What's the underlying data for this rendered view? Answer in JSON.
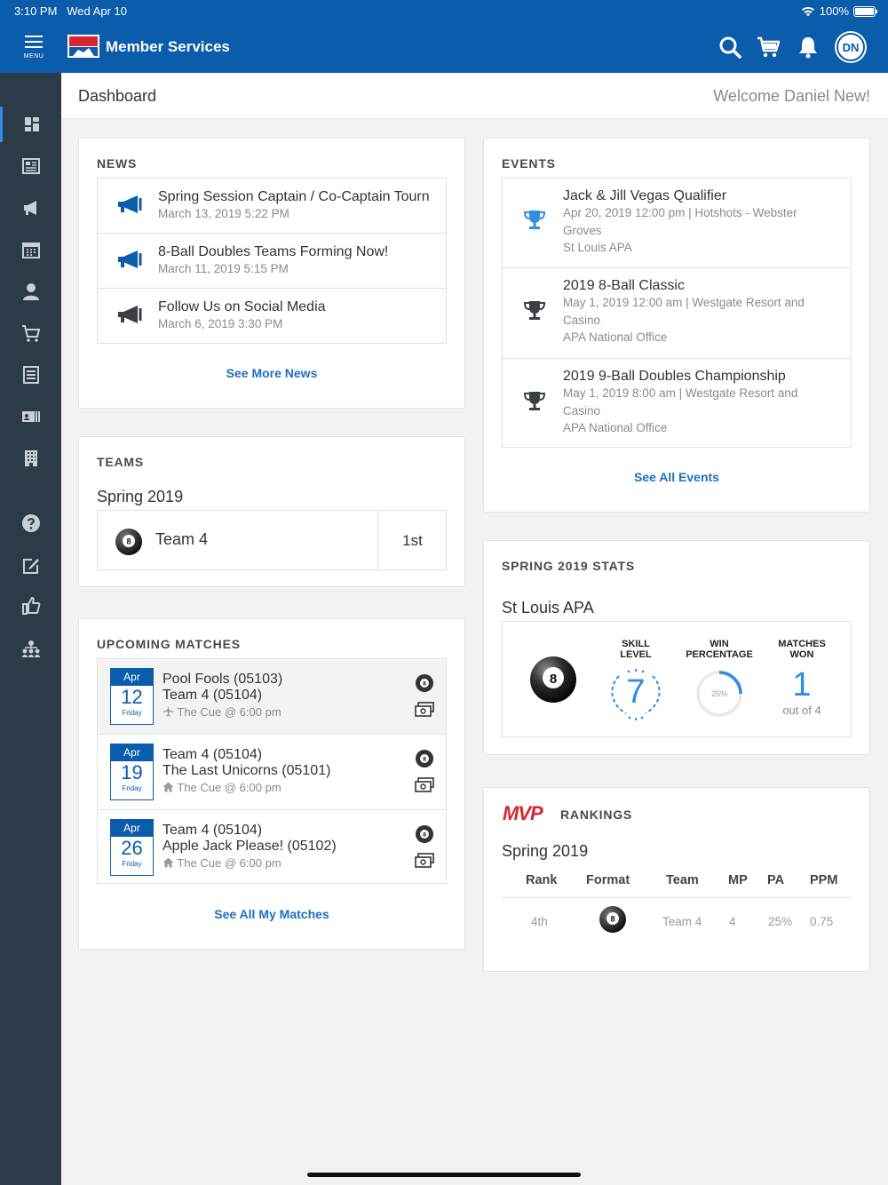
{
  "status_bar": {
    "time": "3:10 PM",
    "date": "Wed Apr 10",
    "battery": "100%"
  },
  "app": {
    "menu_label": "MENU",
    "title": "Member Services",
    "avatar_initials": "DN"
  },
  "page": {
    "title": "Dashboard",
    "welcome": "Welcome Daniel New!"
  },
  "news": {
    "title": "NEWS",
    "items": [
      {
        "title": "Spring Session Captain / Co-Captain Tournament",
        "date": "March 13, 2019 5:22 PM"
      },
      {
        "title": "8-Ball Doubles Teams Forming Now!",
        "date": "March 11, 2019 5:15 PM"
      },
      {
        "title": "Follow Us on Social Media",
        "date": "March 6, 2019 3:30 PM"
      }
    ],
    "more_link": "See More News"
  },
  "teams": {
    "title": "TEAMS",
    "season": "Spring 2019",
    "team": {
      "name": "Team 4",
      "rank": "1st"
    }
  },
  "upcoming": {
    "title": "UPCOMING MATCHES",
    "matches": [
      {
        "month": "Apr",
        "day": "12",
        "weekday": "Friday",
        "line1": "Pool Fools (05103)",
        "line2": "Team 4 (05104)",
        "venue": "The Cue @ 6:00 pm"
      },
      {
        "month": "Apr",
        "day": "19",
        "weekday": "Friday",
        "line1": "Team 4 (05104)",
        "line2": "The Last Unicorns (05101)",
        "venue": "The Cue @ 6:00 pm"
      },
      {
        "month": "Apr",
        "day": "26",
        "weekday": "Friday",
        "line1": "Team 4 (05104)",
        "line2": "Apple Jack Please! (05102)",
        "venue": "The Cue @ 6:00 pm"
      }
    ],
    "all_link": "See All My Matches"
  },
  "events": {
    "title": "EVENTS",
    "items": [
      {
        "name": "Jack & Jill Vegas Qualifier",
        "line1": "Apr 20, 2019 12:00 pm | Hotshots - Webster",
        "line2": "Groves",
        "org": "St Louis APA"
      },
      {
        "name": "2019 8-Ball Classic",
        "line1": "May 1, 2019 12:00 am | Westgate Resort and",
        "line2": "Casino",
        "org": "APA National Office"
      },
      {
        "name": "2019 9-Ball Doubles Championship",
        "line1": "May 1, 2019 8:00 am | Westgate Resort and",
        "line2": "Casino",
        "org": "APA National Office"
      }
    ],
    "all_link": "See All Events"
  },
  "stats": {
    "title": "SPRING 2019 STATS",
    "league": "St Louis APA",
    "skill_label_1": "SKILL",
    "skill_label_2": "LEVEL",
    "skill_level": "7",
    "win_label_1": "WIN",
    "win_label_2": "PERCENTAGE",
    "win_pct_text": "25%",
    "win_pct": 25,
    "matches_label_1": "MATCHES",
    "matches_label_2": "WON",
    "matches_won": "1",
    "matches_of": "out of 4"
  },
  "rankings": {
    "logo": "MVP",
    "title": "RANKINGS",
    "season": "Spring 2019",
    "headers": {
      "rank": "Rank",
      "format": "Format",
      "team": "Team",
      "mp": "MP",
      "pa": "PA",
      "ppm": "PPM"
    },
    "row": {
      "rank": "4th",
      "team": "Team 4",
      "mp": "4",
      "pa": "25%",
      "ppm": "0.75"
    }
  },
  "ball_number": "8",
  "colors": {
    "brand": "#0b5cab",
    "sidebar": "#2d3a48",
    "link": "#1f6fbf",
    "accent": "#2f8de4"
  }
}
